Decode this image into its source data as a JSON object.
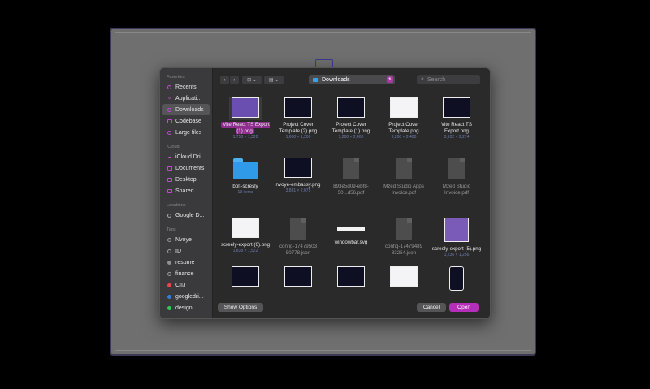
{
  "sidebar": {
    "favorites_label": "Favorites",
    "favorites": [
      {
        "label": "Recents",
        "icon": "clock-icon"
      },
      {
        "label": "Applicati...",
        "icon": "applications-icon"
      },
      {
        "label": "Downloads",
        "icon": "downloads-icon"
      },
      {
        "label": "Codebase",
        "icon": "folder-icon"
      },
      {
        "label": "Large files",
        "icon": "folder-icon"
      }
    ],
    "icloud_label": "iCloud",
    "icloud": [
      {
        "label": "iCloud Dri...",
        "icon": "cloud-icon"
      },
      {
        "label": "Documents",
        "icon": "folder-icon"
      },
      {
        "label": "Desktop",
        "icon": "desktop-icon"
      },
      {
        "label": "Shared",
        "icon": "shared-folder-icon"
      }
    ],
    "locations_label": "Locations",
    "locations": [
      {
        "label": "Google D...",
        "icon": "drive-icon"
      }
    ],
    "tags_label": "Tags",
    "tags": [
      {
        "label": "Nvoye",
        "color": ""
      },
      {
        "label": "ID",
        "color": ""
      },
      {
        "label": "resume",
        "color": "#8e8e93"
      },
      {
        "label": "finance",
        "color": ""
      },
      {
        "label": "CIIJ",
        "color": "#e5484d"
      },
      {
        "label": "googledri...",
        "color": "#2f7fe0"
      },
      {
        "label": "design",
        "color": "#34c759"
      }
    ]
  },
  "toolbar": {
    "back": "‹",
    "forward": "›",
    "icon_view": "⊞ ⌄",
    "group_view": "▤ ⌄",
    "location": "Downloads",
    "search_placeholder": "Search"
  },
  "files": [
    {
      "name": "Vite React TS Export (1).png",
      "meta": "1,758 × 1,320",
      "kind": "shot-dark",
      "selected": true
    },
    {
      "name": "Project Cover Template (2).png",
      "meta": "1,600 × 1,200",
      "kind": "shot-dark"
    },
    {
      "name": "Project Cover Template (1).png",
      "meta": "3,200 × 2,400",
      "kind": "shot-dark"
    },
    {
      "name": "Project Cover Template.png",
      "meta": "3,200 × 2,400",
      "kind": "shot-light"
    },
    {
      "name": "Vite React TS Export.png",
      "meta": "3,932 × 2,274",
      "kind": "shot-dark"
    },
    {
      "name": "bolt-scresly",
      "meta": "13 items",
      "kind": "folder"
    },
    {
      "name": "nvoye-embassy.png",
      "meta": "3,831 × 2,075",
      "kind": "shot-dark"
    },
    {
      "name": "893e5d09-ebf8-50...d56.pdf",
      "meta": "",
      "kind": "doc",
      "dim": true
    },
    {
      "name": "Mzed Studio Apps Invoice.pdf",
      "meta": "",
      "kind": "doc",
      "dim": true
    },
    {
      "name": "Mzed Studio Invoice.pdf",
      "meta": "",
      "kind": "doc",
      "dim": true
    },
    {
      "name": "screely-export (6).png",
      "meta": "1,838 × 1,522",
      "kind": "shot-light"
    },
    {
      "name": "config-17479503 50778.json",
      "meta": "",
      "kind": "doc",
      "dim": true
    },
    {
      "name": "windowbar.svg",
      "meta": "",
      "kind": "bar"
    },
    {
      "name": "config-17479489 83254.json",
      "meta": "",
      "kind": "doc",
      "dim": true
    },
    {
      "name": "screely-export (5).png",
      "meta": "1,236 × 1,256",
      "kind": "shot-purple"
    },
    {
      "name": "",
      "meta": "",
      "kind": "shot-dark"
    },
    {
      "name": "",
      "meta": "",
      "kind": "shot-dark"
    },
    {
      "name": "",
      "meta": "",
      "kind": "shot-dark"
    },
    {
      "name": "",
      "meta": "",
      "kind": "shot-light"
    },
    {
      "name": "",
      "meta": "",
      "kind": "phone"
    }
  ],
  "footer": {
    "show_options": "Show Options",
    "cancel": "Cancel",
    "open": "Open"
  },
  "colors": {
    "accent": "#b32fb8",
    "folder": "#2e9ae8",
    "selection": "#8e2e8f"
  }
}
